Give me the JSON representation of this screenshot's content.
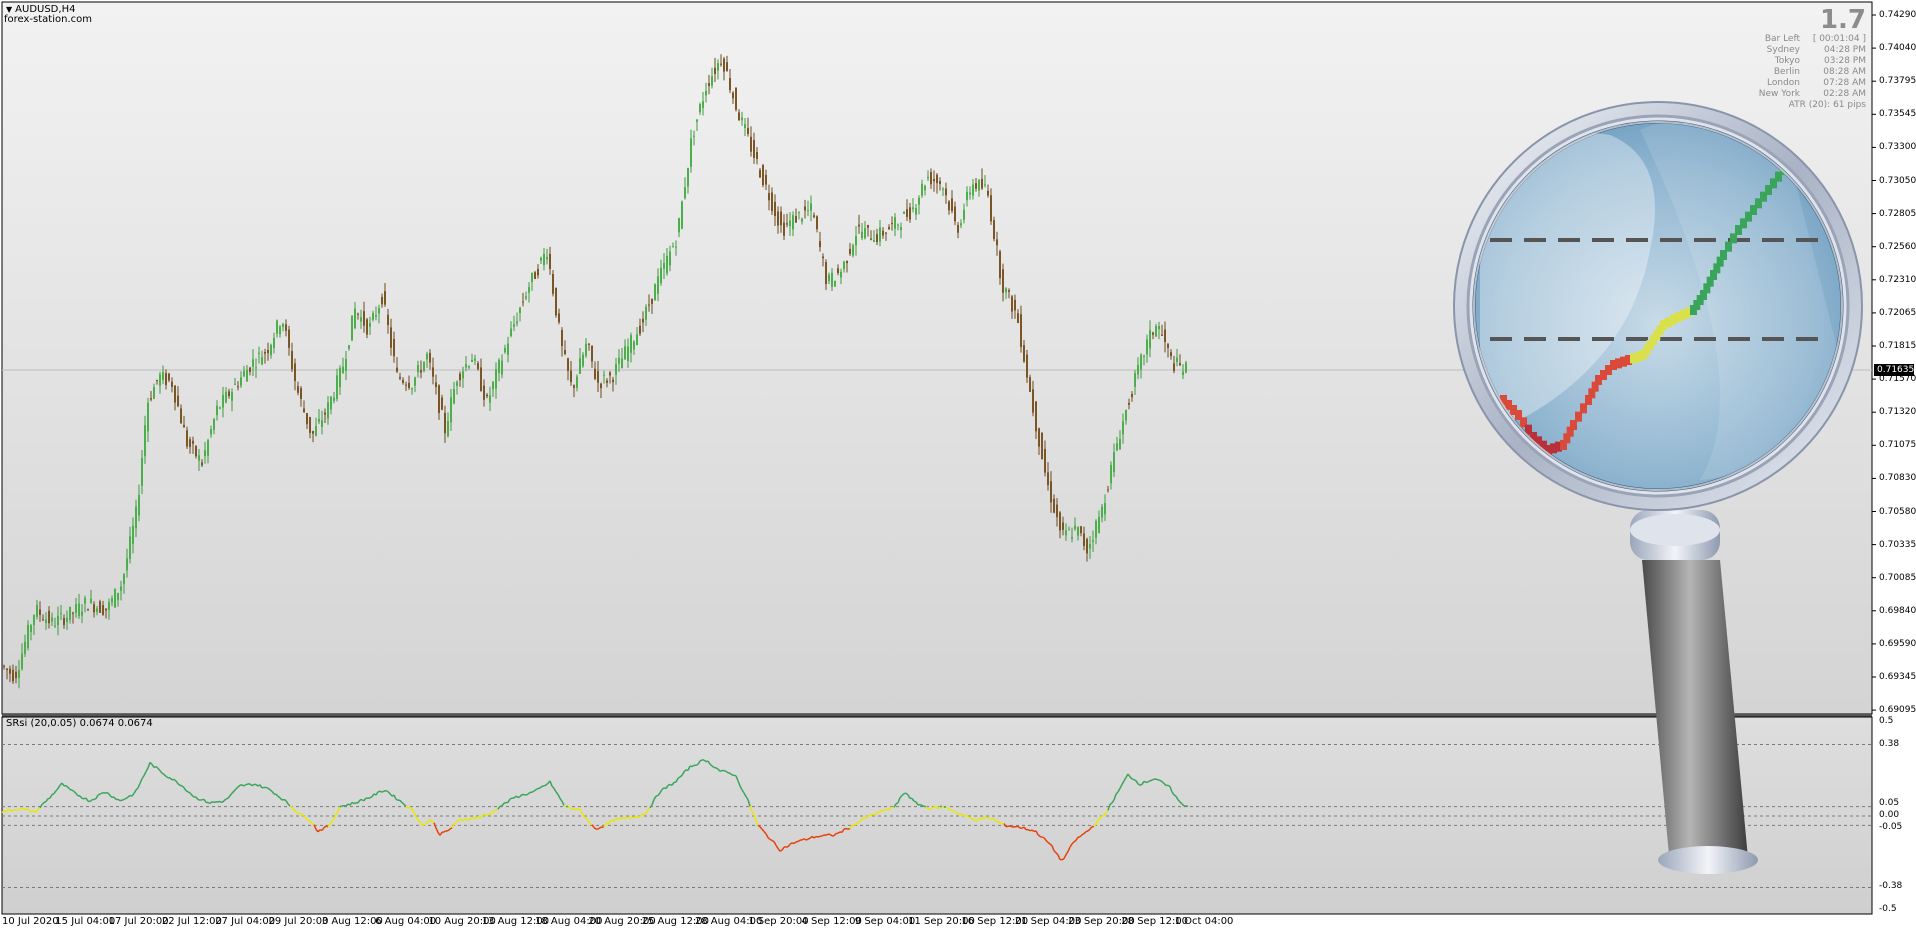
{
  "window": {
    "symbol": "AUDUSD,H4",
    "broker": "forex-station.com"
  },
  "info_panel": {
    "value": "1.7",
    "rows": [
      {
        "label": "Bar Left",
        "value": "[ 00:01:04 ]"
      },
      {
        "label": "Sydney",
        "value": "04:28 PM"
      },
      {
        "label": "Tokyo",
        "value": "03:28 PM"
      },
      {
        "label": "Berlin",
        "value": "08:28 AM"
      },
      {
        "label": "London",
        "value": "07:28 AM"
      },
      {
        "label": "New York",
        "value": "02:28 AM"
      }
    ],
    "atr": "ATR (20): 61 pips"
  },
  "indicator": {
    "label": "SRsi (20,0.05) 0.0674 0.0674"
  },
  "price_axis": {
    "ticks": [
      "0.74290",
      "0.74040",
      "0.73795",
      "0.73545",
      "0.73300",
      "0.73050",
      "0.72805",
      "0.72560",
      "0.72310",
      "0.72065",
      "0.71815",
      "0.71570",
      "0.71320",
      "0.71075",
      "0.70830",
      "0.70580",
      "0.70335",
      "0.70085",
      "0.69840",
      "0.69590",
      "0.69345",
      "0.69095"
    ],
    "current_price": "0.71635"
  },
  "indicator_axis": {
    "ticks": [
      "0.5",
      "0.38",
      "0.05",
      "0.00",
      "-0.05",
      "-0.38",
      "-0.5"
    ]
  },
  "time_axis": {
    "ticks": [
      "10 Jul 2020",
      "15 Jul 04:00",
      "17 Jul 20:00",
      "22 Jul 12:00",
      "27 Jul 04:00",
      "29 Jul 20:00",
      "3 Aug 12:00",
      "6 Aug 04:00",
      "10 Aug 20:00",
      "13 Aug 12:00",
      "18 Aug 04:00",
      "20 Aug 20:00",
      "25 Aug 12:00",
      "28 Aug 04:00",
      "1 Sep 20:00",
      "4 Sep 12:00",
      "9 Sep 04:00",
      "11 Sep 20:00",
      "16 Sep 12:00",
      "21 Sep 04:00",
      "23 Sep 20:00",
      "28 Sep 12:00",
      "1 Oct 04:00"
    ]
  },
  "chart_data": {
    "type": "candlestick",
    "price_range": [
      0.69095,
      0.7429
    ],
    "path_keypoints": [
      [
        0,
        0.6945
      ],
      [
        18,
        0.6935
      ],
      [
        38,
        0.6985
      ],
      [
        55,
        0.6975
      ],
      [
        70,
        0.698
      ],
      [
        90,
        0.699
      ],
      [
        110,
        0.6985
      ],
      [
        125,
        0.7005
      ],
      [
        140,
        0.706
      ],
      [
        150,
        0.714
      ],
      [
        162,
        0.716
      ],
      [
        175,
        0.7155
      ],
      [
        190,
        0.711
      ],
      [
        205,
        0.7095
      ],
      [
        220,
        0.7135
      ],
      [
        240,
        0.7155
      ],
      [
        255,
        0.717
      ],
      [
        270,
        0.718
      ],
      [
        285,
        0.7205
      ],
      [
        300,
        0.715
      ],
      [
        315,
        0.7115
      ],
      [
        330,
        0.7135
      ],
      [
        345,
        0.7165
      ],
      [
        358,
        0.721
      ],
      [
        372,
        0.7195
      ],
      [
        385,
        0.722
      ],
      [
        400,
        0.716
      ],
      [
        415,
        0.7155
      ],
      [
        430,
        0.7175
      ],
      [
        448,
        0.712
      ],
      [
        460,
        0.716
      ],
      [
        475,
        0.7175
      ],
      [
        490,
        0.714
      ],
      [
        510,
        0.7185
      ],
      [
        530,
        0.7225
      ],
      [
        550,
        0.7255
      ],
      [
        565,
        0.718
      ],
      [
        575,
        0.715
      ],
      [
        590,
        0.7185
      ],
      [
        600,
        0.7155
      ],
      [
        615,
        0.716
      ],
      [
        630,
        0.718
      ],
      [
        645,
        0.72
      ],
      [
        660,
        0.723
      ],
      [
        680,
        0.7265
      ],
      [
        695,
        0.734
      ],
      [
        710,
        0.738
      ],
      [
        725,
        0.74
      ],
      [
        740,
        0.736
      ],
      [
        755,
        0.733
      ],
      [
        770,
        0.73
      ],
      [
        785,
        0.727
      ],
      [
        800,
        0.728
      ],
      [
        815,
        0.7285
      ],
      [
        830,
        0.723
      ],
      [
        845,
        0.724
      ],
      [
        860,
        0.727
      ],
      [
        880,
        0.7265
      ],
      [
        900,
        0.7275
      ],
      [
        915,
        0.7285
      ],
      [
        930,
        0.731
      ],
      [
        945,
        0.7305
      ],
      [
        960,
        0.727
      ],
      [
        975,
        0.7305
      ],
      [
        990,
        0.73
      ],
      [
        1005,
        0.723
      ],
      [
        1020,
        0.7205
      ],
      [
        1035,
        0.714
      ],
      [
        1050,
        0.708
      ],
      [
        1065,
        0.704
      ],
      [
        1080,
        0.7045
      ],
      [
        1090,
        0.703
      ],
      [
        1105,
        0.706
      ],
      [
        1120,
        0.711
      ],
      [
        1135,
        0.715
      ],
      [
        1150,
        0.7185
      ],
      [
        1160,
        0.72
      ],
      [
        1175,
        0.717
      ],
      [
        1188,
        0.7165
      ]
    ],
    "indicator": {
      "name": "SRsi",
      "range": [
        -0.5,
        0.5
      ],
      "levels": [
        0.38,
        0.05,
        0.0,
        -0.05,
        -0.38
      ],
      "colors": {
        "up": "#3aa55a",
        "neutral": "#e8e800",
        "down": "#e8400a"
      },
      "keypoints": [
        [
          0,
          0.02
        ],
        [
          20,
          0.04
        ],
        [
          35,
          0.02
        ],
        [
          50,
          0.1
        ],
        [
          62,
          0.17
        ],
        [
          75,
          0.12
        ],
        [
          90,
          0.08
        ],
        [
          105,
          0.13
        ],
        [
          120,
          0.08
        ],
        [
          135,
          0.12
        ],
        [
          150,
          0.28
        ],
        [
          165,
          0.22
        ],
        [
          180,
          0.17
        ],
        [
          195,
          0.1
        ],
        [
          210,
          0.07
        ],
        [
          225,
          0.08
        ],
        [
          240,
          0.16
        ],
        [
          255,
          0.17
        ],
        [
          270,
          0.14
        ],
        [
          285,
          0.08
        ],
        [
          300,
          0.01
        ],
        [
          310,
          -0.02
        ],
        [
          318,
          -0.08
        ],
        [
          330,
          -0.05
        ],
        [
          340,
          0.05
        ],
        [
          355,
          0.07
        ],
        [
          370,
          0.1
        ],
        [
          385,
          0.14
        ],
        [
          400,
          0.08
        ],
        [
          413,
          0.03
        ],
        [
          422,
          -0.05
        ],
        [
          432,
          -0.02
        ],
        [
          440,
          -0.1
        ],
        [
          450,
          -0.07
        ],
        [
          460,
          -0.02
        ],
        [
          475,
          -0.01
        ],
        [
          490,
          0.01
        ],
        [
          500,
          0.05
        ],
        [
          515,
          0.1
        ],
        [
          535,
          0.13
        ],
        [
          550,
          0.18
        ],
        [
          565,
          0.05
        ],
        [
          580,
          0.03
        ],
        [
          595,
          -0.07
        ],
        [
          605,
          -0.05
        ],
        [
          615,
          -0.02
        ],
        [
          630,
          -0.01
        ],
        [
          645,
          0.01
        ],
        [
          660,
          0.13
        ],
        [
          675,
          0.18
        ],
        [
          690,
          0.26
        ],
        [
          705,
          0.3
        ],
        [
          720,
          0.24
        ],
        [
          735,
          0.22
        ],
        [
          748,
          0.08
        ],
        [
          758,
          -0.05
        ],
        [
          770,
          -0.12
        ],
        [
          780,
          -0.18
        ],
        [
          795,
          -0.14
        ],
        [
          815,
          -0.11
        ],
        [
          835,
          -0.1
        ],
        [
          850,
          -0.06
        ],
        [
          865,
          -0.01
        ],
        [
          880,
          0.02
        ],
        [
          895,
          0.05
        ],
        [
          905,
          0.13
        ],
        [
          915,
          0.07
        ],
        [
          930,
          0.04
        ],
        [
          945,
          0.05
        ],
        [
          960,
          0.01
        ],
        [
          975,
          -0.02
        ],
        [
          990,
          -0.01
        ],
        [
          1005,
          -0.05
        ],
        [
          1020,
          -0.06
        ],
        [
          1035,
          -0.08
        ],
        [
          1050,
          -0.15
        ],
        [
          1062,
          -0.24
        ],
        [
          1075,
          -0.13
        ],
        [
          1090,
          -0.07
        ],
        [
          1105,
          0.01
        ],
        [
          1115,
          0.1
        ],
        [
          1128,
          0.22
        ],
        [
          1140,
          0.17
        ],
        [
          1155,
          0.2
        ],
        [
          1170,
          0.15
        ],
        [
          1180,
          0.07
        ],
        [
          1188,
          0.05
        ]
      ]
    }
  },
  "magnifier": {
    "description_icon": "magnifier-icon"
  }
}
